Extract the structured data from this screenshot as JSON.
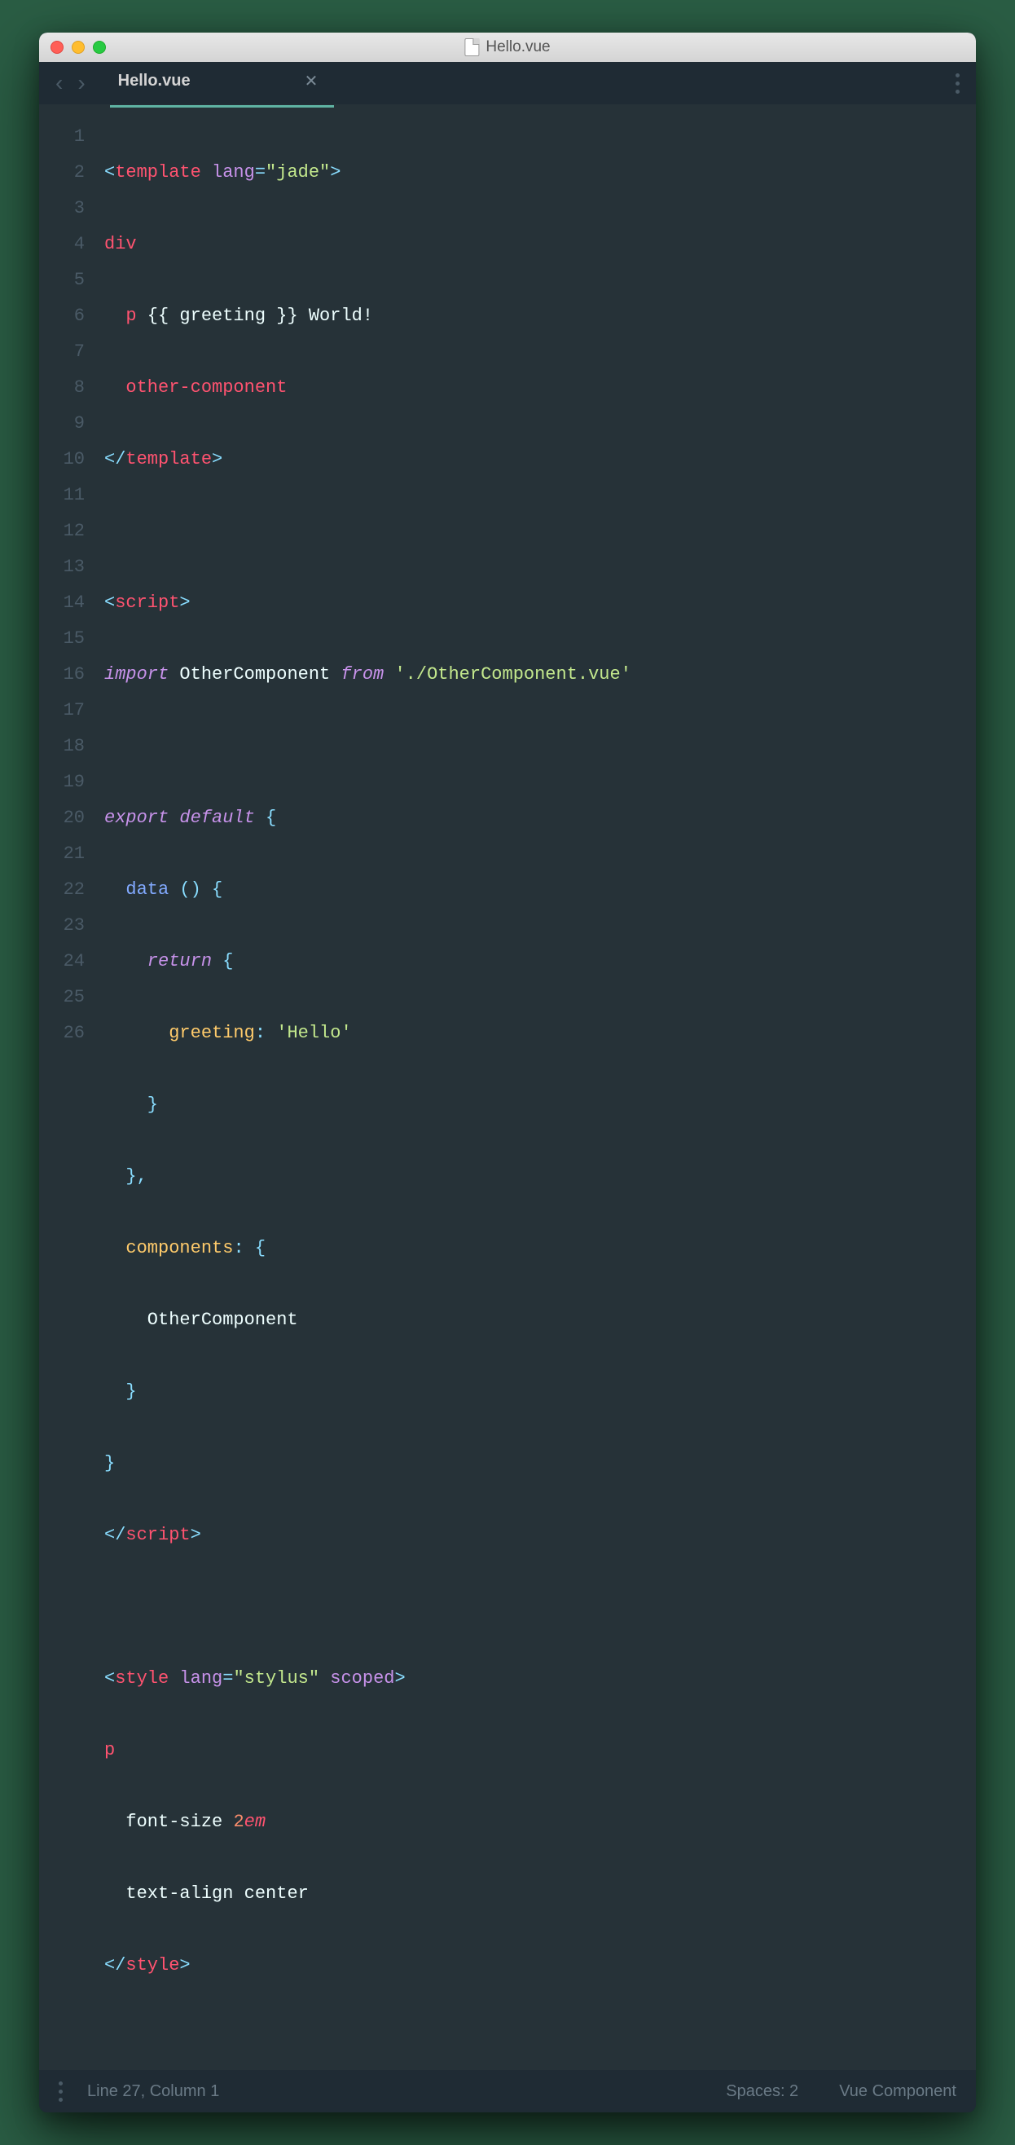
{
  "window": {
    "title": "Hello.vue"
  },
  "tab": {
    "title": "Hello.vue"
  },
  "code": {
    "lines": [
      1,
      2,
      3,
      4,
      5,
      6,
      7,
      8,
      9,
      10,
      11,
      12,
      13,
      14,
      15,
      16,
      17,
      18,
      19,
      20,
      21,
      22,
      23,
      24,
      25,
      26
    ],
    "l1": {
      "a": "<",
      "b": "template",
      "c": " lang",
      "d": "=",
      "e": "\"jade\"",
      "f": ">"
    },
    "l2": {
      "a": "div"
    },
    "l3": {
      "a": "  p",
      "b": " {{ greeting }} World!"
    },
    "l4": {
      "a": "  other-component"
    },
    "l5": {
      "a": "</",
      "b": "template",
      "c": ">"
    },
    "l7": {
      "a": "<",
      "b": "script",
      "c": ">"
    },
    "l8": {
      "a": "import",
      "b": " OtherComponent ",
      "c": "from",
      "d": " './OtherComponent.vue'"
    },
    "l10": {
      "a": "export",
      "b": " default",
      "c": " {"
    },
    "l11": {
      "a": "  data",
      "b": " ()",
      "c": " {"
    },
    "l12": {
      "a": "    return",
      "b": " {"
    },
    "l13": {
      "a": "      greeting",
      "b": ":",
      "c": " 'Hello'"
    },
    "l14": {
      "a": "    }"
    },
    "l15": {
      "a": "  }",
      "b": ","
    },
    "l16": {
      "a": "  components",
      "b": ":",
      "c": " {"
    },
    "l17": {
      "a": "    OtherComponent"
    },
    "l18": {
      "a": "  }"
    },
    "l19": {
      "a": "}"
    },
    "l20": {
      "a": "</",
      "b": "script",
      "c": ">"
    },
    "l22": {
      "a": "<",
      "b": "style",
      "c": " lang",
      "d": "=",
      "e": "\"stylus\"",
      "f": " scoped",
      "g": ">"
    },
    "l23": {
      "a": "p"
    },
    "l24": {
      "a": "  font-size ",
      "b": "2",
      "c": "em"
    },
    "l25": {
      "a": "  text-align ",
      "b": "center"
    },
    "l26": {
      "a": "</",
      "b": "style",
      "c": ">"
    }
  },
  "status": {
    "cursor": "Line 27, Column 1",
    "spaces": "Spaces: 2",
    "syntax": "Vue Component"
  }
}
